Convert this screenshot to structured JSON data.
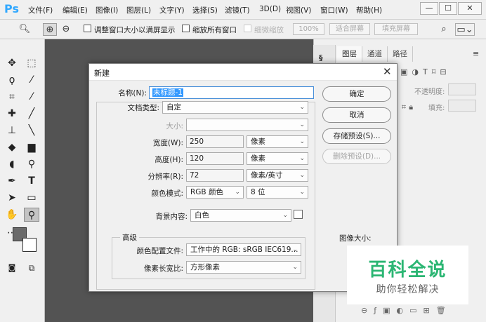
{
  "app": {
    "logo": "Ps"
  },
  "menu": [
    "文件(F)",
    "编辑(E)",
    "图像(I)",
    "图层(L)",
    "文字(Y)",
    "选择(S)",
    "滤镜(T)",
    "3D(D)",
    "视图(V)",
    "窗口(W)",
    "帮助(H)"
  ],
  "window_controls": {
    "minimize": "—",
    "restore": "☐",
    "close": "✕"
  },
  "options_bar": {
    "resize_window_label": "调整窗口大小以满屏显示",
    "zoom_all_label": "缩放所有窗口",
    "scrubby_zoom_label": "细微缩放",
    "zoom_percent": "100%",
    "fit_screen": "适合屏幕",
    "fill_screen": "填充屏幕"
  },
  "right_panel": {
    "tabs": [
      "图层",
      "通道",
      "路径"
    ],
    "opacity_label": "不透明度:",
    "fill_label": "填充:"
  },
  "dialog": {
    "title": "新建",
    "close": "✕",
    "name_label": "名称(N):",
    "name_value": "未标题-1",
    "doc_type_label": "文档类型:",
    "doc_type_value": "自定",
    "size_label": "大小:",
    "width_label": "宽度(W):",
    "width_value": "250",
    "width_unit": "像素",
    "height_label": "高度(H):",
    "height_value": "120",
    "height_unit": "像素",
    "resolution_label": "分辨率(R):",
    "resolution_value": "72",
    "resolution_unit": "像素/英寸",
    "color_mode_label": "颜色模式:",
    "color_mode_value": "RGB 颜色",
    "bit_depth_value": "8 位",
    "background_label": "背景内容:",
    "background_value": "白色",
    "advanced_label": "高级",
    "color_profile_label": "颜色配置文件:",
    "color_profile_value": "工作中的 RGB: sRGB IEC619...",
    "pixel_aspect_label": "像素长宽比:",
    "pixel_aspect_value": "方形像素",
    "image_size_label": "图像大小:",
    "ok_button": "确定",
    "cancel_button": "取消",
    "save_preset_button": "存储预设(S)...",
    "delete_preset_button": "删除预设(D)..."
  },
  "watermark": {
    "title": "百科全说",
    "subtitle": "助你轻松解决"
  },
  "colors": {
    "accent": "#31a8ff",
    "selection": "#3399ff",
    "watermark_green": "#2bb673"
  }
}
